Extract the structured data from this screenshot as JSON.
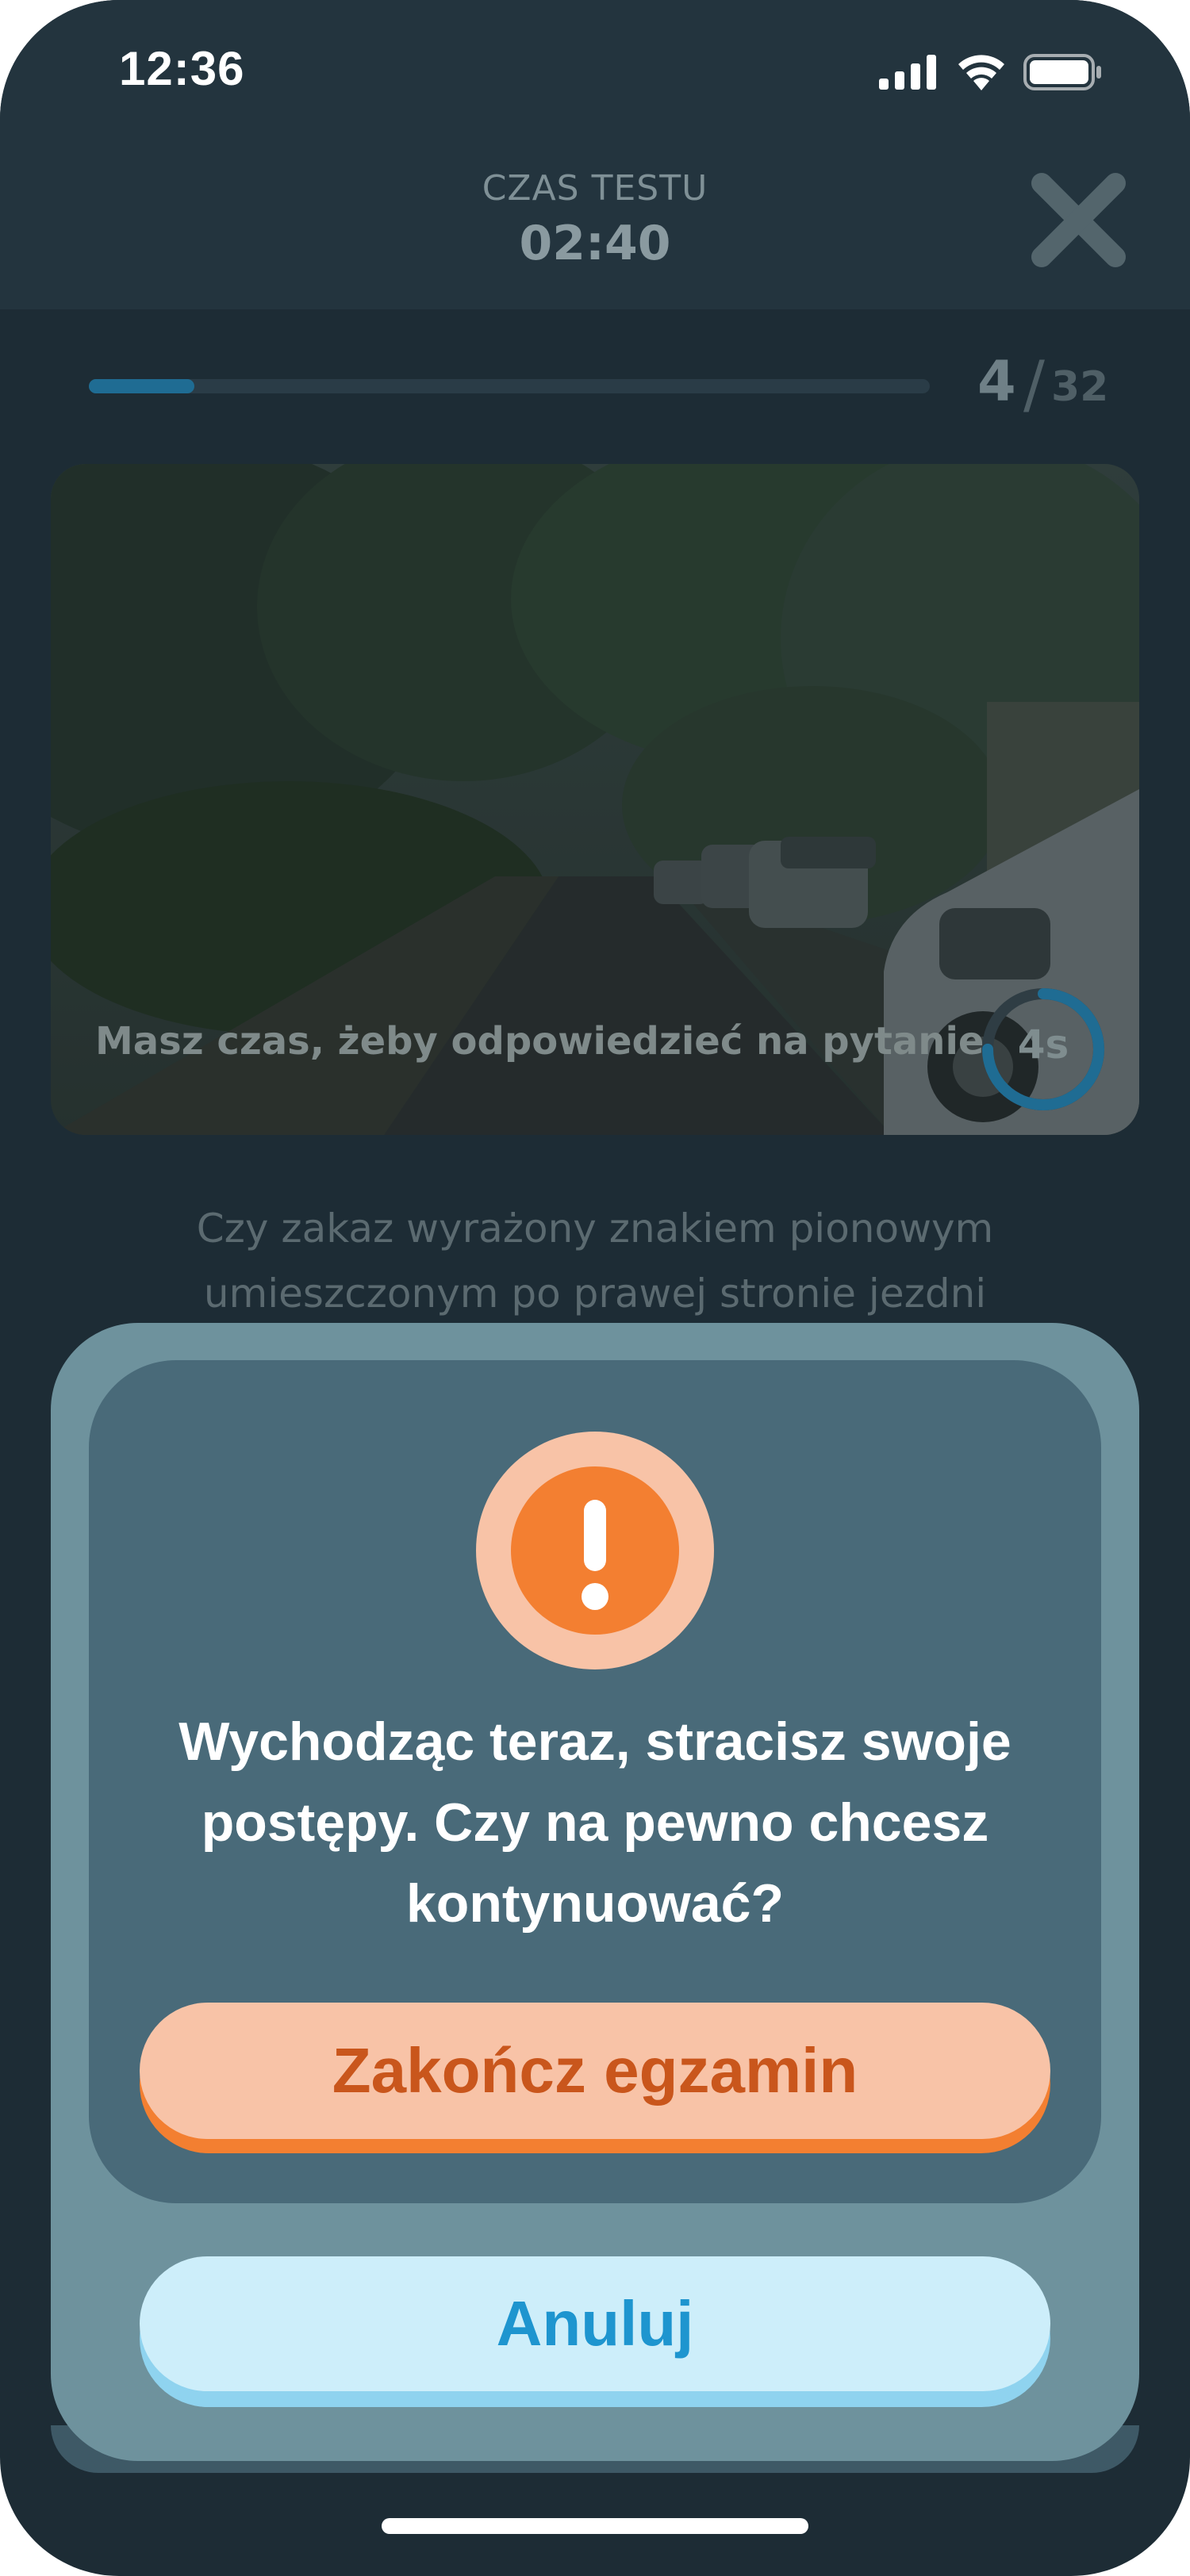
{
  "status_bar": {
    "time": "12:36"
  },
  "header": {
    "title": "CZAS TESTU",
    "timer": "02:40",
    "close_icon": "close-icon"
  },
  "progress": {
    "current": "4",
    "separator": "/",
    "total": "32",
    "fraction": 0.125
  },
  "video": {
    "caption": "Masz czas, żeby odpowiedzieć na pytanie",
    "countdown": "4s",
    "countdown_fraction": 0.75
  },
  "question": {
    "text": "Czy zakaz wyrażony znakiem pionowym umieszczonym po prawej stronie jezdni"
  },
  "modal": {
    "icon": "exclamation-icon",
    "message": "Wychodząc teraz, stracisz swoje postępy. Czy na pewno chcesz kontynuować?",
    "end_button": "Zakończ egzamin",
    "cancel_button": "Anuluj"
  },
  "colors": {
    "background": "#1d2c35",
    "header": "#23343e",
    "modal_outer": "#6e929d",
    "modal_inner": "#496a79",
    "warning_orange": "#f37f31",
    "warning_peach": "#f8c3a7",
    "end_text": "#c9561c",
    "cancel_bg": "#cdeefa",
    "cancel_text": "#1e95cf"
  }
}
